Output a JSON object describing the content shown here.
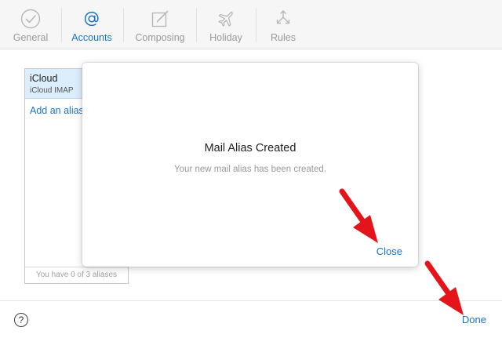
{
  "toolbar": {
    "tabs": [
      {
        "label": "General",
        "icon": "check-circle-icon",
        "active": false
      },
      {
        "label": "Accounts",
        "icon": "at-sign-icon",
        "active": true
      },
      {
        "label": "Composing",
        "icon": "compose-icon",
        "active": false
      },
      {
        "label": "Holiday",
        "icon": "airplane-icon",
        "active": false
      },
      {
        "label": "Rules",
        "icon": "rules-arrows-icon",
        "active": false
      }
    ]
  },
  "accounts": {
    "items": [
      {
        "name": "iCloud",
        "type": "iCloud IMAP"
      }
    ],
    "add_alias_label": "Add an alias",
    "alias_count_text": "You have 0 of 3 aliases"
  },
  "dialog": {
    "title": "Mail Alias Created",
    "message": "Your new mail alias has been created.",
    "close_label": "Close"
  },
  "footer": {
    "help_label": "?",
    "done_label": "Done"
  },
  "colors": {
    "accent": "#1a73c8",
    "annotation": "#e4141b"
  }
}
